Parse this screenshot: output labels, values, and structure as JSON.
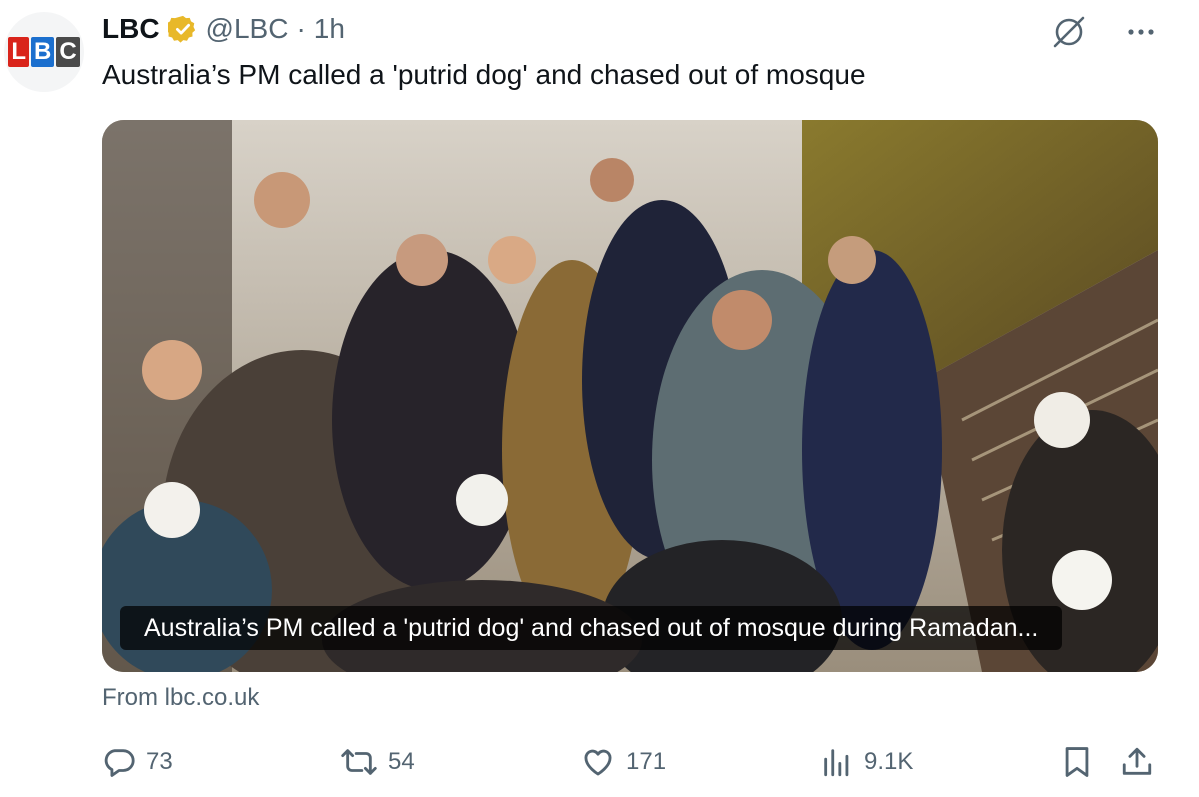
{
  "account": {
    "avatar_letters": [
      "L",
      "B",
      "C"
    ],
    "name": "LBC",
    "handle": "@LBC",
    "separator": "·",
    "time": "1h"
  },
  "tweet": {
    "text": "Australia’s PM called a 'putrid dog' and chased out of mosque"
  },
  "card": {
    "caption": "Australia’s PM called a 'putrid dog' and chased out of mosque during Ramadan...",
    "source": "From lbc.co.uk"
  },
  "actions": {
    "replies": "73",
    "reposts": "54",
    "likes": "171",
    "views": "9.1K"
  },
  "icons": {
    "top": [
      "grok-icon",
      "more-icon"
    ],
    "bottom": [
      "reply-icon",
      "repost-icon",
      "like-icon",
      "views-icon",
      "bookmark-icon",
      "share-icon"
    ]
  },
  "colors": {
    "text": "#0f1419",
    "secondary": "#536471",
    "verified": "#e8b829",
    "logo_red": "#d9241b",
    "logo_blue": "#1b6fce",
    "logo_dark": "#4a4a4a"
  }
}
